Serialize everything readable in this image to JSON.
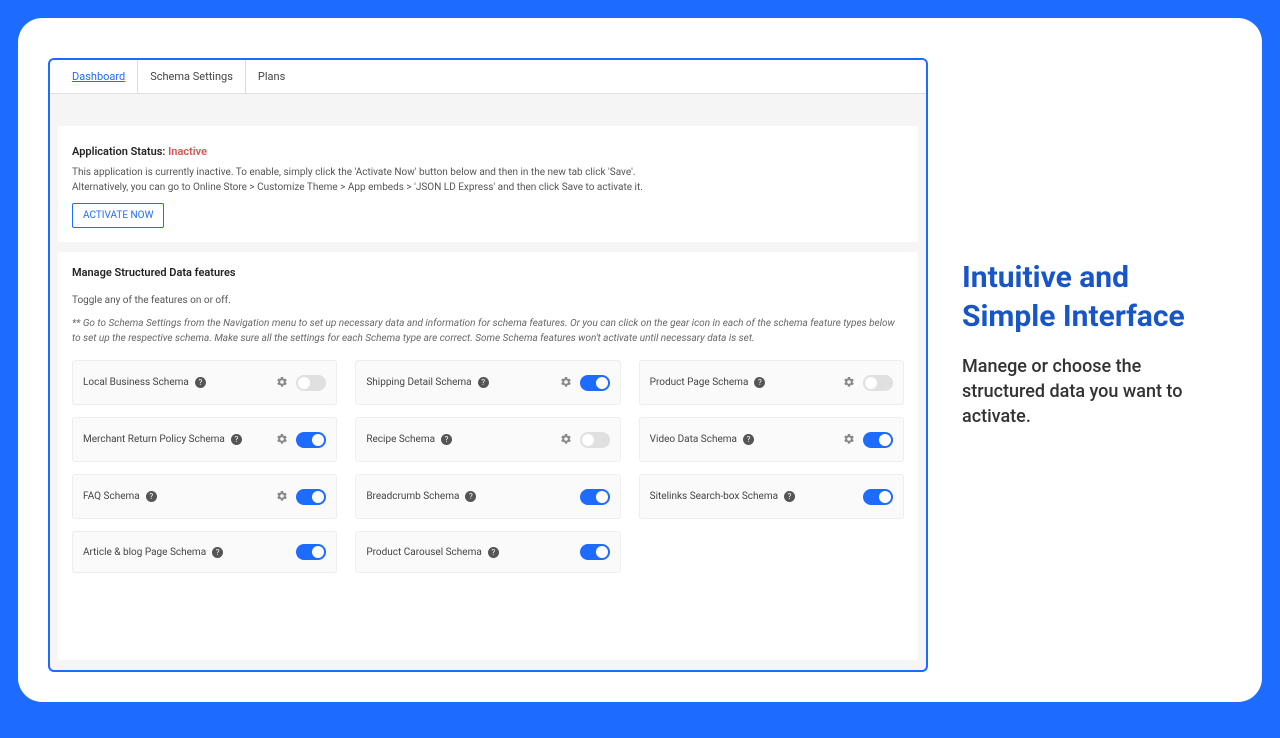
{
  "tabs": [
    "Dashboard",
    "Schema Settings",
    "Plans"
  ],
  "status": {
    "label": "Application Status: ",
    "value": "Inactive",
    "desc1": "This application is currently inactive. To enable, simply click the 'Activate Now' button below and then in the new tab click 'Save'.",
    "desc2": "Alternatively, you can go to Online Store > Customize Theme > App embeds > 'JSON LD Express' and then click Save to activate it.",
    "button": "ACTIVATE NOW"
  },
  "features": {
    "title": "Manage Structured Data features",
    "sub": "Toggle any of the features on or off.",
    "note": "** Go to Schema Settings from the Navigation menu to set up necessary data and information for schema features. Or you can click on the gear icon in each of the schema feature types below to set up the respective schema. Make sure all the settings for each Schema type are correct. Some Schema features won't activate until necessary data is set.",
    "items": [
      {
        "label": "Local Business Schema",
        "gear": true,
        "on": false
      },
      {
        "label": "Shipping Detail Schema",
        "gear": true,
        "on": true
      },
      {
        "label": "Product Page Schema",
        "gear": true,
        "on": false
      },
      {
        "label": "Merchant Return Policy Schema",
        "gear": true,
        "on": true
      },
      {
        "label": "Recipe Schema",
        "gear": true,
        "on": false
      },
      {
        "label": "Video Data Schema",
        "gear": true,
        "on": true
      },
      {
        "label": "FAQ Schema",
        "gear": true,
        "on": true
      },
      {
        "label": "Breadcrumb Schema",
        "gear": false,
        "on": true
      },
      {
        "label": "Sitelinks Search-box Schema",
        "gear": false,
        "on": true
      },
      {
        "label": "Article & blog Page Schema",
        "gear": false,
        "on": true
      },
      {
        "label": "Product Carousel Schema",
        "gear": false,
        "on": true
      }
    ]
  },
  "side": {
    "title": "Intuitive and Simple Interface",
    "desc": "Manege or choose the structured data you want to activate."
  }
}
